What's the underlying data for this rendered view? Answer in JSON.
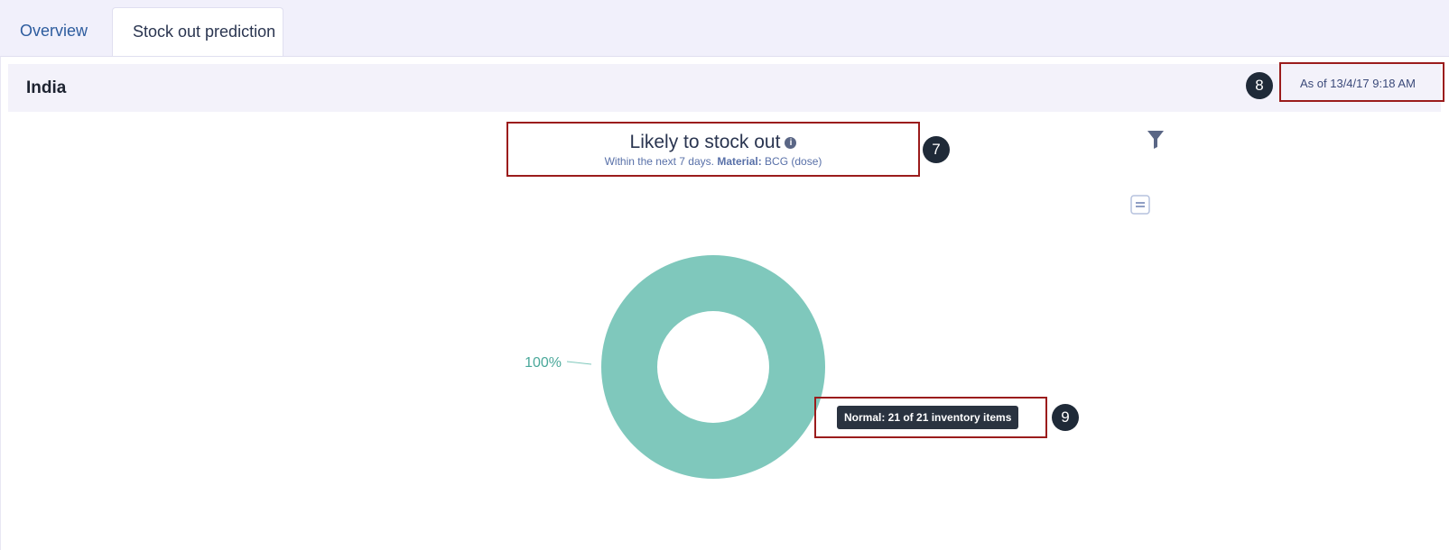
{
  "tabs": [
    {
      "label": "Overview"
    },
    {
      "label": "Stock out prediction"
    }
  ],
  "header": {
    "location": "India",
    "as_of": "As of 13/4/17 9:18 AM"
  },
  "markers": {
    "as_of": "8",
    "title": "7",
    "tooltip": "9"
  },
  "chart": {
    "title": "Likely to stock out",
    "subtitle_prefix": "Within the next 7 days.",
    "subtitle_material_label": "Material:",
    "subtitle_material_value": "BCG (dose)",
    "tooltip": "Normal: 21 of 21 inventory items"
  },
  "chart_data": {
    "type": "pie",
    "donut": true,
    "slices": [
      {
        "label": "100%",
        "value": 100,
        "color": "#7fc8bc"
      }
    ]
  },
  "icons": {
    "info": "info-icon",
    "filter": "filter-icon",
    "list": "list-icon"
  },
  "colors": {
    "slice": "#7fc8bc",
    "marker": "#1f2a38",
    "highlight": "#9b1c1c"
  }
}
